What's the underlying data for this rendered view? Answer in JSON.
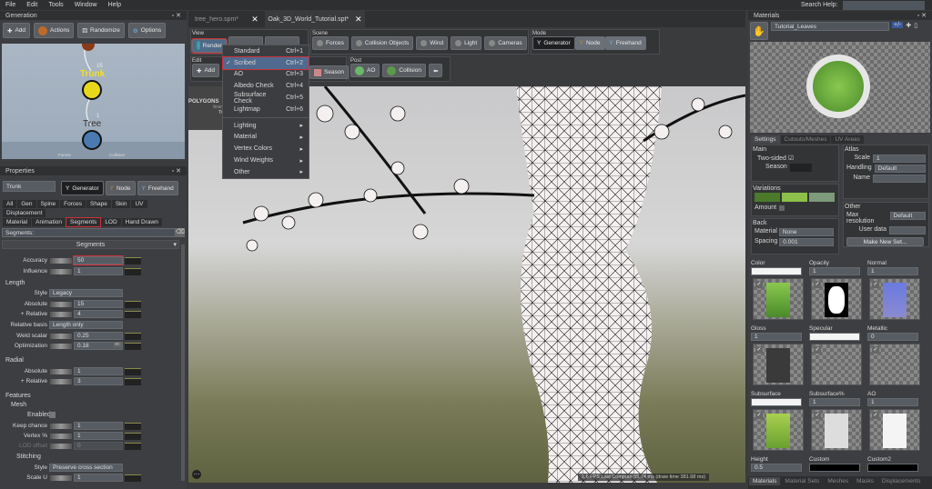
{
  "menubar": {
    "items": [
      "File",
      "Edit",
      "Tools",
      "Window",
      "Help"
    ],
    "search_label": "Search Help:"
  },
  "generation": {
    "title": "Generation",
    "buttons": [
      "Add",
      "Actions",
      "Randomize",
      "Options"
    ],
    "nodes": {
      "trunk": "Trunk",
      "tree": "Tree",
      "trunk_count": "15",
      "tree_count": "1",
      "forces": "Forces",
      "collision": "Collision"
    }
  },
  "properties": {
    "title": "Properties",
    "name_value": "Trunk",
    "modes": [
      "Generator",
      "Node",
      "Freehand"
    ],
    "tabs_row1": [
      "All",
      "Gen",
      "Spine",
      "Forces",
      "Shape",
      "Skin",
      "UV",
      "Displacement"
    ],
    "tabs_row2": [
      "Material",
      "Animation",
      "Segments",
      "LOD",
      "Hand Drawn"
    ],
    "filter_label": "Segments:",
    "section": "Segments",
    "accuracy": {
      "label": "Accuracy",
      "value": "50"
    },
    "influence": {
      "label": "Influence",
      "value": "1"
    },
    "length": {
      "title": "Length",
      "style_label": "Style",
      "style_value": "Legacy",
      "absolute_label": "Absolute",
      "absolute_value": "15",
      "relative_label": "+ Relative",
      "relative_value": "4",
      "basis_label": "Relative basis",
      "basis_value": "Length only",
      "weld_label": "Weld scalar",
      "weld_value": "0.25",
      "opt_label": "Optimization",
      "opt_value": "0.18",
      "pm": "+/-"
    },
    "radial": {
      "title": "Radial",
      "absolute_label": "Absolute",
      "absolute_value": "1",
      "relative_label": "+ Relative",
      "relative_value": "3"
    },
    "features": {
      "title": "Features",
      "mesh": "Mesh",
      "enabled": "Enabled",
      "keep_label": "Keep chance",
      "keep_value": "1",
      "vertex_label": "Vertex %",
      "vertex_value": "1",
      "lod_label": "LOD offset",
      "lod_value": "0",
      "stitching": "Stitching",
      "style_label": "Style",
      "style_value": "Preserve cross section",
      "scaleu_label": "Scale U",
      "scaleu_value": "1"
    }
  },
  "doc_tabs": [
    {
      "label": "tree_hero.spm*"
    },
    {
      "label": "Oak_3D_World_Tutorial.spt*"
    }
  ],
  "toolbar": {
    "view": "View",
    "render": "Render",
    "scene": "Scene",
    "scene_buttons": [
      "Forces",
      "Collision Objects",
      "Wind",
      "Light",
      "Cameras"
    ],
    "mode": "Mode",
    "mode_buttons": [
      "Generator",
      "Node",
      "Freehand"
    ],
    "edit": "Edit",
    "add": "Add",
    "season": "Season",
    "post": "Post",
    "post_buttons": [
      "AO",
      "Collision"
    ]
  },
  "render_menu": {
    "items": [
      {
        "label": "Standard",
        "shortcut": "Ctrl+1"
      },
      {
        "label": "Scribed",
        "shortcut": "Ctrl+2",
        "checked": true
      },
      {
        "label": "AO",
        "shortcut": "Ctrl+3"
      },
      {
        "label": "Albedo Check",
        "shortcut": "Ctrl+4"
      },
      {
        "label": "Subsurface Check",
        "shortcut": "Ctrl+5"
      },
      {
        "label": "Lightmap",
        "shortcut": "Ctrl+6"
      }
    ],
    "submenus": [
      "Lighting",
      "Material",
      "Vertex Colors",
      "Wind Weights",
      "Other"
    ]
  },
  "viewport": {
    "overlay_title": "POLYGONS",
    "overlay_sub1": "branches",
    "overlay_sub2": "TOTAL",
    "status": "1,6 FPS  Last Compute 55.74 ms (draw time 381.68 ms)"
  },
  "materials": {
    "title": "Materials",
    "selected": "Tutorial_Leaves",
    "tabs": [
      "Settings",
      "Cutouts/Meshes",
      "UV Areas"
    ],
    "main": {
      "title": "Main",
      "two_sided": "Two-sided",
      "season": "Season"
    },
    "variations": {
      "title": "Variations",
      "amount": "Amount",
      "colors": [
        "#4a7a2a",
        "#8cc04a",
        "#7d9a7a"
      ]
    },
    "back": {
      "title": "Back",
      "material_label": "Material",
      "material_value": "None",
      "spacing_label": "Spacing",
      "spacing_value": "0.001"
    },
    "atlas": {
      "title": "Atlas",
      "scale_label": "Scale",
      "scale_value": "1",
      "handling_label": "Handling",
      "handling_value": "Default",
      "name_label": "Name"
    },
    "other": {
      "title": "Other",
      "maxres_label": "Max resolution",
      "maxres_value": "Default",
      "userdata_label": "User data",
      "make_set": "Make New Set..."
    },
    "maps": [
      {
        "label": "Color",
        "value": ""
      },
      {
        "label": "Opacity",
        "value": "1"
      },
      {
        "label": "Normal",
        "value": "1"
      },
      {
        "label": "Gloss",
        "value": "1"
      },
      {
        "label": "Specular",
        "value": ""
      },
      {
        "label": "Metallic",
        "value": "0"
      },
      {
        "label": "Subsurface",
        "value": ""
      },
      {
        "label": "Subsurface%",
        "value": "1"
      },
      {
        "label": "AO",
        "value": "1"
      },
      {
        "label": "Height",
        "value": "0.5"
      },
      {
        "label": "Custom",
        "value": ""
      },
      {
        "label": "Custom2",
        "value": ""
      }
    ],
    "bottom_tabs": [
      "Materials",
      "Material Sets",
      "Meshes",
      "Masks",
      "Displacements"
    ]
  }
}
